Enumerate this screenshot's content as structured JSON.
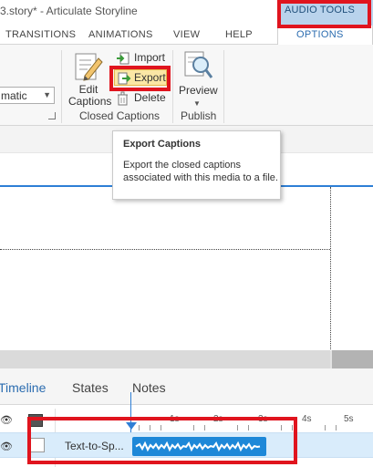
{
  "window": {
    "title": "3.story* - Articulate Storyline",
    "contextual_tab_group": "AUDIO TOOLS"
  },
  "tabs": {
    "transitions": "TRANSITIONS",
    "animations": "ANIMATIONS",
    "view": "VIEW",
    "help": "HELP",
    "options": "OPTIONS"
  },
  "ribbon": {
    "dropdown_value": "matic",
    "edit_captions": "Edit Captions",
    "import": "Import",
    "export": "Export",
    "delete": "Delete",
    "closed_captions_group": "Closed Captions",
    "preview": "Preview",
    "publish_group": "Publish"
  },
  "tooltip": {
    "title": "Export Captions",
    "body": "Export the closed captions associated with this media to a file."
  },
  "timeline": {
    "tabs": [
      "Timeline",
      "States",
      "Notes"
    ],
    "ruler_labels": [
      "1s",
      "2s",
      "3s",
      "4s",
      "5s"
    ],
    "track_name": "Text-to-Sp..."
  },
  "colors": {
    "accent_blue": "#2e7fd6",
    "highlight_red": "#e0141e",
    "contextual_tab": "#b9d3ec",
    "audio_block": "#1e88d8"
  }
}
